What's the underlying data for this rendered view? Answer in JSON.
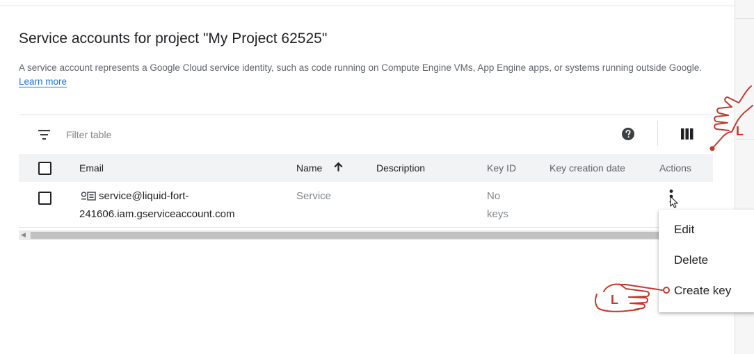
{
  "page": {
    "title": "Service accounts for project \"My Project 62525\"",
    "description": "A service account represents a Google Cloud service identity, such as code running on Compute Engine VMs, App Engine apps, or systems running outside Google.",
    "learn_more": "Learn more"
  },
  "toolbar": {
    "filter_placeholder": "Filter table",
    "icons": [
      "filter-icon",
      "help-icon",
      "column-display-icon"
    ]
  },
  "table": {
    "headers": [
      "Email",
      "Name",
      "Description",
      "Key ID",
      "Key creation date",
      "Actions"
    ],
    "sort_column": "Name",
    "sort_direction": "ascending",
    "rows": [
      {
        "email_line1": "service@liquid-fort-",
        "email_line2": "241606.iam.gserviceaccount.com",
        "name": "Service",
        "description": "",
        "key_id_line1": "No",
        "key_id_line2": "keys",
        "key_creation_date": ""
      }
    ]
  },
  "actions_menu": {
    "items": [
      "Edit",
      "Delete",
      "Create key"
    ]
  },
  "annotations": {
    "hand_label": "L"
  },
  "colors": {
    "link": "#1a73e8",
    "header_bg": "#f1f3f4",
    "annotation": "#c0392b"
  }
}
